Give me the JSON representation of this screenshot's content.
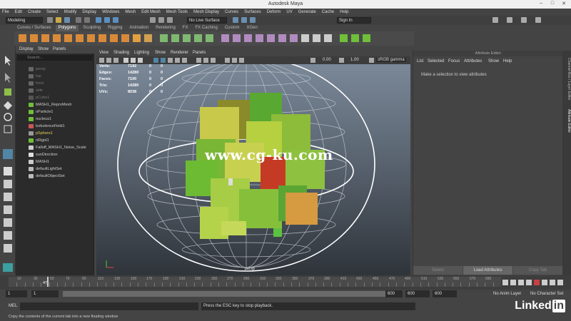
{
  "window": {
    "title": "Autodesk Maya"
  },
  "menubar": [
    "File",
    "Edit",
    "Create",
    "Select",
    "Modify",
    "Display",
    "Windows",
    "Mesh",
    "Edit Mesh",
    "Mesh Tools",
    "Mesh Display",
    "Curves",
    "Surfaces",
    "Deform",
    "UV",
    "Generate",
    "Cache",
    "Help"
  ],
  "statusline": {
    "mode": "Modeling",
    "live_surface": "No Live Surface",
    "sign_in": "Sign In"
  },
  "shelf_tabs": [
    "Curves / Surfaces",
    "Polygons",
    "Sculpting",
    "Rigging",
    "Animation",
    "Rendering",
    "FX",
    "FX Caching",
    "Custom",
    "XGen"
  ],
  "shelf_active": "Polygons",
  "outliner": {
    "menu": [
      "Display",
      "Show",
      "Panels"
    ],
    "search_placeholder": "Search...",
    "items": [
      {
        "label": "persp",
        "style": "dim"
      },
      {
        "label": "top",
        "style": "dim"
      },
      {
        "label": "front",
        "style": "dim"
      },
      {
        "label": "side",
        "style": "dim"
      },
      {
        "label": "pCube1",
        "style": "dim"
      },
      {
        "label": "MASH1_ReproMesh",
        "style": "normal"
      },
      {
        "label": "nParticle1",
        "style": "normal"
      },
      {
        "label": "nucleus1",
        "style": "normal"
      },
      {
        "label": "turbulenceField1",
        "style": "normal"
      },
      {
        "label": "pSphere1",
        "style": "hl"
      },
      {
        "label": "nRigid1",
        "style": "normal"
      },
      {
        "label": "Falloff_MASH1_Noise_Scale",
        "style": "normal"
      },
      {
        "label": "sunDirection",
        "style": "normal"
      },
      {
        "label": "MASH1",
        "style": "normal"
      },
      {
        "label": "defaultLightSet",
        "style": "normal"
      },
      {
        "label": "defaultObjectSet",
        "style": "normal"
      }
    ]
  },
  "viewport": {
    "menu": [
      "View",
      "Shading",
      "Lighting",
      "Show",
      "Renderer",
      "Panels"
    ],
    "toolbar": {
      "val1": "0.00",
      "val2": "1.00",
      "colorspace": "sRGB gamma"
    },
    "hud": [
      {
        "k": "Verts:",
        "v": "7192",
        "a": "0",
        "b": "0"
      },
      {
        "k": "Edges:",
        "v": "14280",
        "a": "0",
        "b": "0"
      },
      {
        "k": "Faces:",
        "v": "7100",
        "a": "0",
        "b": "0"
      },
      {
        "k": "Tris:",
        "v": "14280",
        "a": "0",
        "b": "0"
      },
      {
        "k": "UVs:",
        "v": "8038",
        "a": "0",
        "b": "0"
      }
    ],
    "camera": "persp",
    "watermark": "www.cg-ku.com"
  },
  "attribute_editor": {
    "title": "Attribute Editor",
    "menu": [
      "List",
      "Selected",
      "Focus",
      "Attributes",
      "Show",
      "Help"
    ],
    "message": "Make a selection to view attributes",
    "buttons": [
      "Select",
      "Load Attributes",
      "Copy Tab"
    ],
    "side_tabs": [
      "Attribute Editor",
      "Channel Box / Layer Editor"
    ]
  },
  "timeline": {
    "current_frame": "47",
    "ticks": [
      "10",
      "20",
      "30",
      "40",
      "50",
      "60",
      "70",
      "80",
      "90",
      "100",
      "110",
      "120",
      "130",
      "140",
      "150",
      "160",
      "170",
      "180",
      "190",
      "200",
      "210",
      "220",
      "230",
      "240",
      "250",
      "260",
      "270",
      "280",
      "290",
      "300",
      "310",
      "320",
      "330",
      "340",
      "350",
      "360",
      "370",
      "380",
      "390",
      "400",
      "410",
      "420",
      "430",
      "440",
      "450",
      "460",
      "470",
      "480",
      "490",
      "500",
      "510",
      "520",
      "530",
      "540",
      "550",
      "560",
      "570",
      "580",
      "590",
      "600"
    ]
  },
  "range": {
    "start": "1",
    "start2": "1",
    "end": "600",
    "end2": "600",
    "end3": "600",
    "anim_layer": "No Anim Layer",
    "char_set": "No Character Set"
  },
  "command": {
    "label": "MEL",
    "result": "Press the ESC key to stop playback."
  },
  "helpline": "Copy the contents of the current tab into a new floating window",
  "brand": {
    "text": "Linked",
    "in": "in"
  },
  "colors": {
    "accent": "#5285a6",
    "selected_green": "#6fbf3a",
    "highlight": "#e8d25a"
  }
}
